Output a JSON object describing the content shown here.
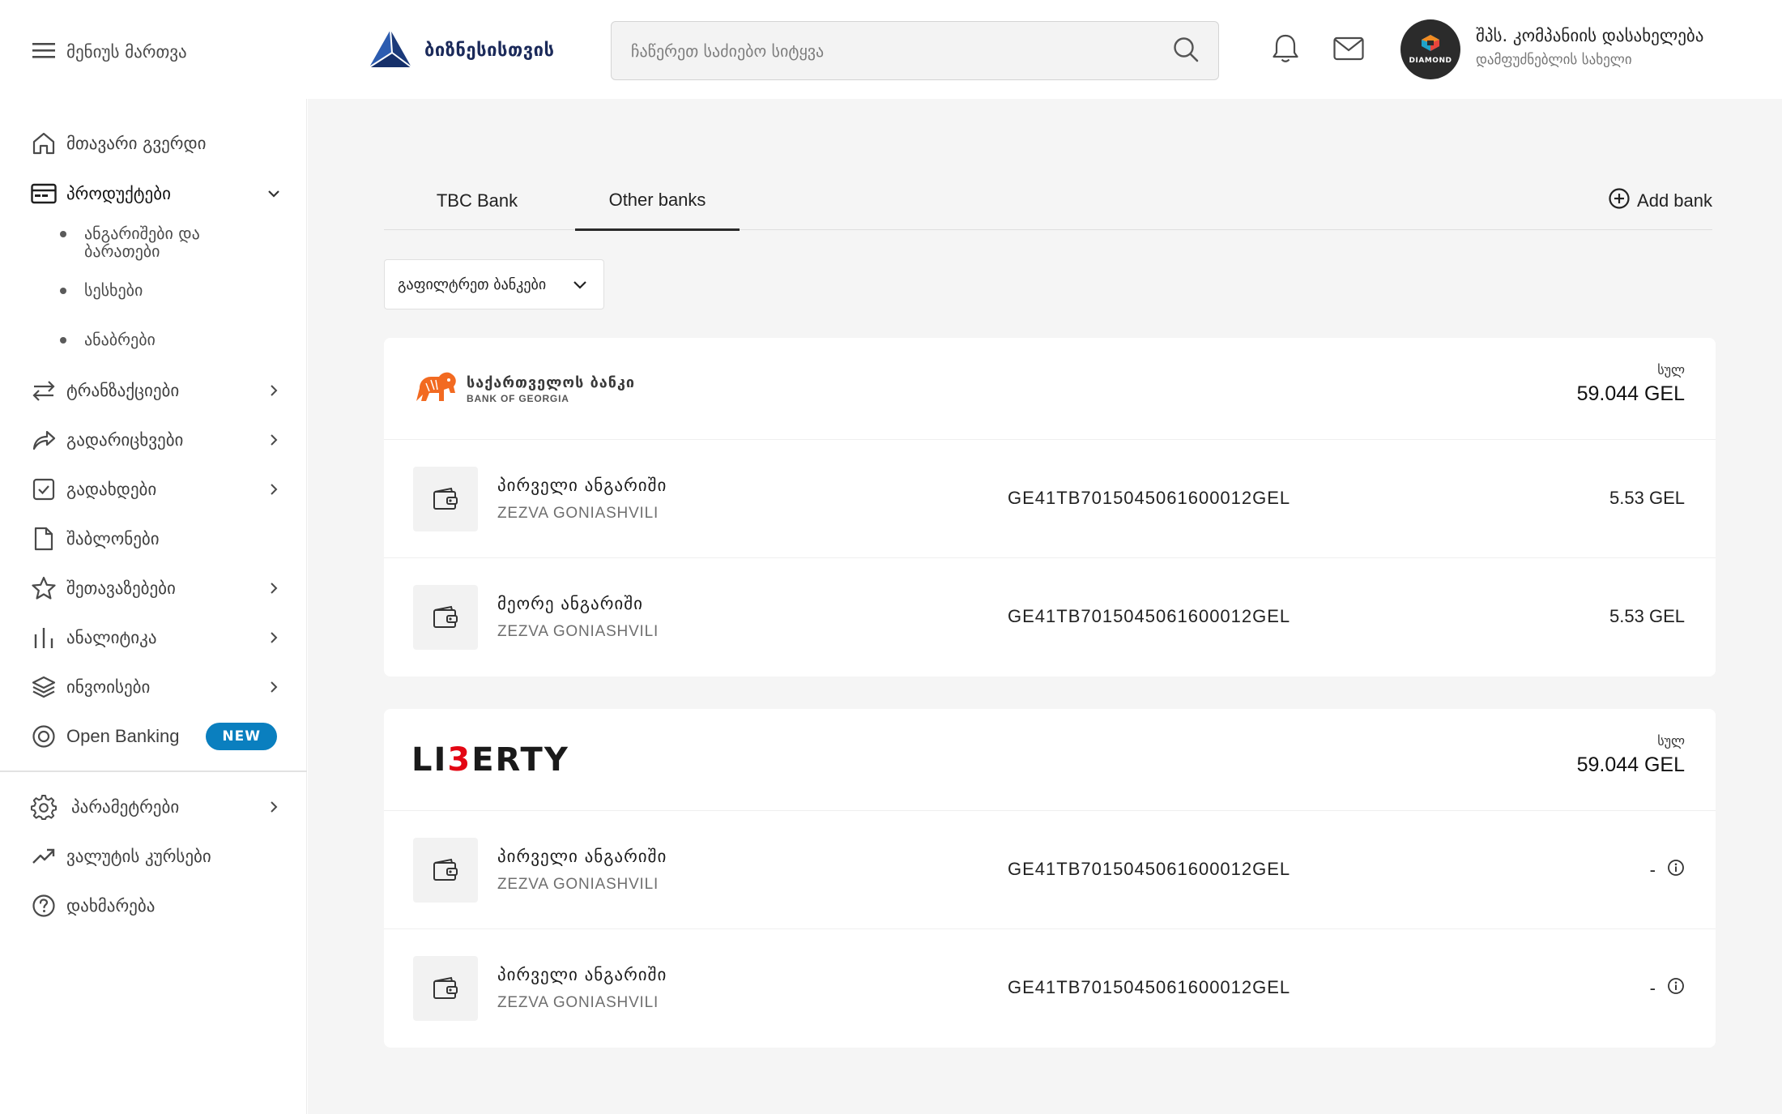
{
  "header": {
    "menu_label": "მენიუს მართვა",
    "logo_text": "ბიზნესისთვის",
    "search_placeholder": "ჩაწერეთ საძიებო სიტყვა",
    "avatar_text": "DIAMOND",
    "company_name": "შპს. კომპანიის დასახელება",
    "company_sub": "დამფუძნებლის სახელი"
  },
  "sidebar": {
    "items": [
      {
        "label": "მთავარი გვერდი",
        "icon": "home-icon"
      },
      {
        "label": "პროდუქტები",
        "icon": "card-icon"
      },
      {
        "label": "ტრანზაქციები",
        "icon": "arrows-swap-icon"
      },
      {
        "label": "გადარიცხვები",
        "icon": "share-arrow-icon"
      },
      {
        "label": "გადახდები",
        "icon": "checkbox-icon"
      },
      {
        "label": "შაბლონები",
        "icon": "document-icon"
      },
      {
        "label": "შეთავაზებები",
        "icon": "star-icon"
      },
      {
        "label": "ანალიტიკა",
        "icon": "bar-chart-icon"
      },
      {
        "label": "ინვოისები",
        "icon": "layers-icon"
      },
      {
        "label": "Open Banking",
        "icon": "target-icon",
        "badge": "NEW"
      },
      {
        "label": "პარამეტრები",
        "icon": "gear-icon"
      },
      {
        "label": "ვალუტის კურსები",
        "icon": "trend-up-icon"
      },
      {
        "label": "დახმარება",
        "icon": "help-icon"
      }
    ],
    "sub_items": [
      "ანგარიშები და ბარათები",
      "სესხები",
      "ანაბრები"
    ]
  },
  "main": {
    "tabs": [
      "TBC Bank",
      "Other banks"
    ],
    "active_tab": "Other banks",
    "add_bank_label": "Add bank",
    "filter_label": "გაფილტრეთ ბანკები",
    "banks": [
      {
        "name": "საქართველოს ბანკი",
        "name_en": "BANK OF GEORGIA",
        "total_label": "სულ",
        "total_value": "59.044 GEL",
        "accounts": [
          {
            "name": "პირველი ანგარიში",
            "owner": "ZEZVA GONIASHVILI",
            "iban": "GE41TB7015045061600012GEL",
            "amount": "5.53 GEL"
          },
          {
            "name": "მეორე ანგარიში",
            "owner": "ZEZVA GONIASHVILI",
            "iban": "GE41TB7015045061600012GEL",
            "amount": "5.53 GEL"
          }
        ]
      },
      {
        "name_part1": "LI",
        "name_part2": "3",
        "name_part3": "ERTY",
        "total_label": "სულ",
        "total_value": "59.044 GEL",
        "accounts": [
          {
            "name": "პირველი ანგარიში",
            "owner": "ZEZVA GONIASHVILI",
            "iban": "GE41TB7015045061600012GEL",
            "amount": "-"
          },
          {
            "name": "პირველი ანგარიში",
            "owner": "ZEZVA GONIASHVILI",
            "iban": "GE41TB7015045061600012GEL",
            "amount": "-"
          }
        ]
      }
    ]
  },
  "colors": {
    "accent": "#0a7fbf",
    "bog_orange": "#f26a21",
    "liberty_red": "#e30613",
    "logo_navy": "#1b3a7a"
  }
}
